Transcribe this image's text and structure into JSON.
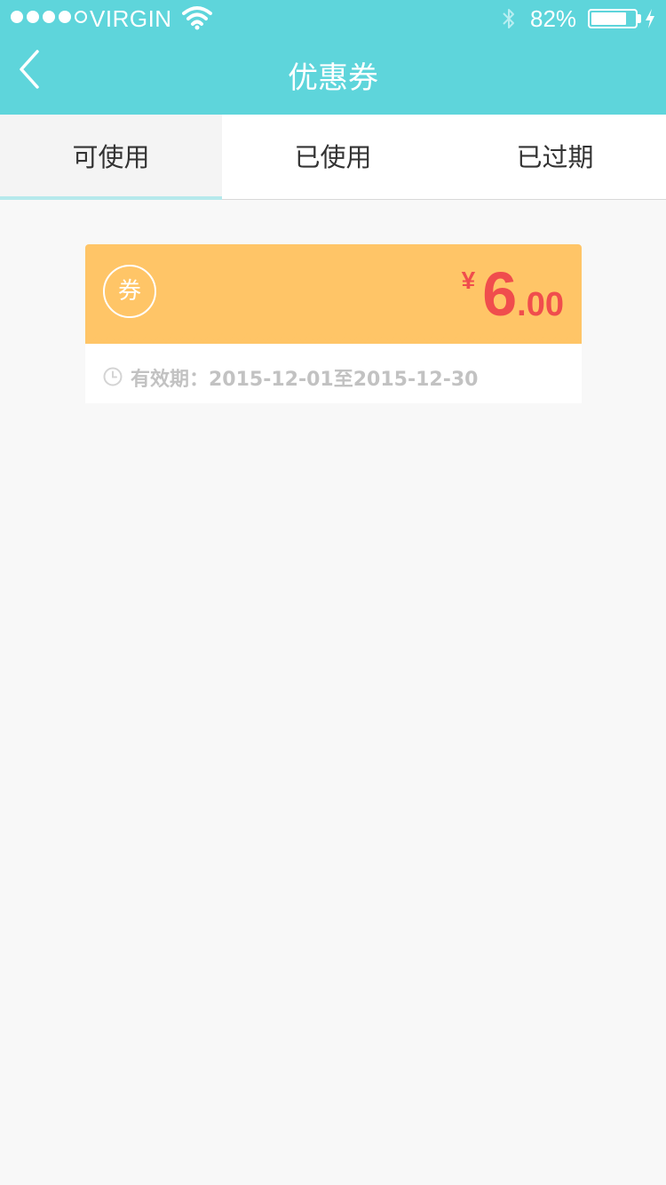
{
  "status_bar": {
    "carrier": "VIRGIN",
    "battery_percent": "82%",
    "battery_level": 0.82
  },
  "nav": {
    "title": "优惠券",
    "back_icon": "chevron-left-icon"
  },
  "tabs": [
    {
      "label": "可使用",
      "active": true
    },
    {
      "label": "已使用",
      "active": false
    },
    {
      "label": "已过期",
      "active": false
    }
  ],
  "coupon": {
    "badge_label": "券",
    "currency": "¥",
    "amount_integer": "6",
    "amount_decimal": ".00",
    "validity": "有效期：2015-12-01至2015-12-30"
  },
  "colors": {
    "header": "#5ed5db",
    "coupon_top": "#ffc567",
    "amount": "#f04d4d",
    "tab_indicator": "#b5e9ec"
  }
}
